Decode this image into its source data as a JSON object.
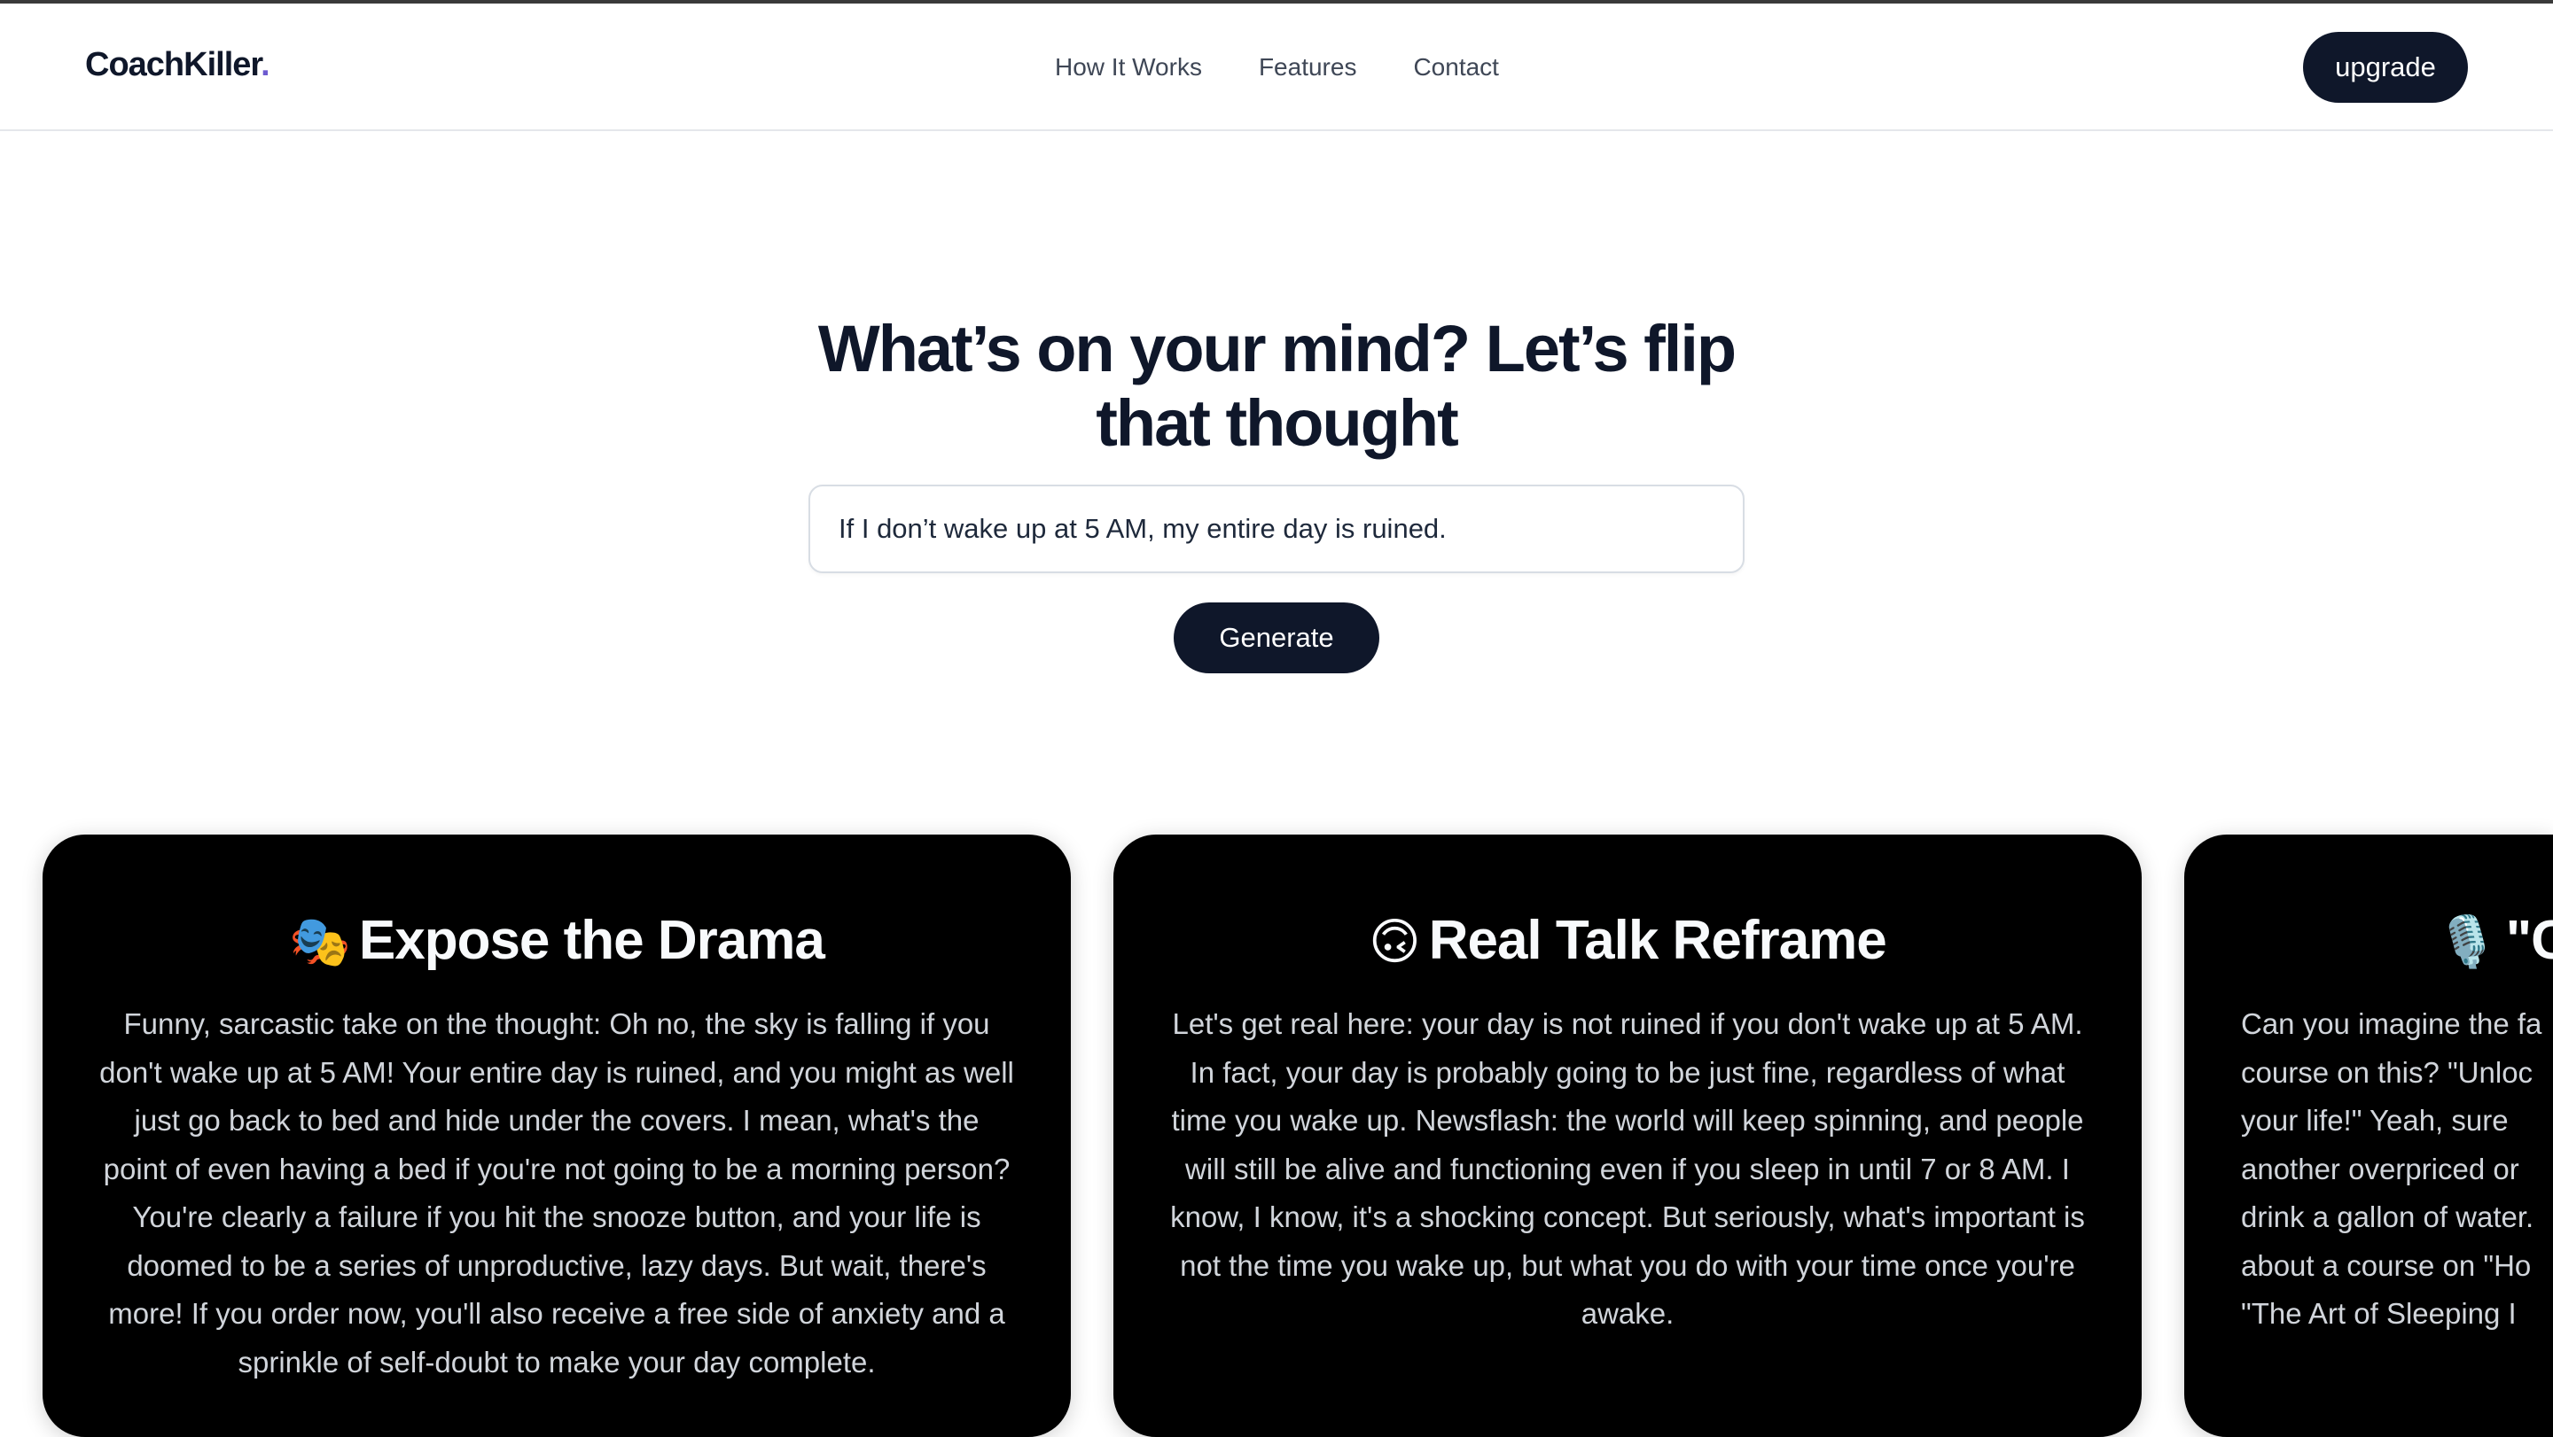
{
  "brand": {
    "name": "CoachKiller",
    "dot": "."
  },
  "nav": {
    "links": [
      "How It Works",
      "Features",
      "Contact"
    ],
    "upgrade_label": "upgrade"
  },
  "hero": {
    "title": "What’s on your mind? Let’s flip that thought",
    "input_value": "If I don’t wake up at 5 AM, my entire day is ruined.",
    "generate_label": "Generate"
  },
  "cards": [
    {
      "icon": "🎭",
      "icon_name": "performing-arts-icon",
      "title": "Expose the Drama",
      "body": "Funny, sarcastic take on the thought: Oh no, the sky is falling if you don't wake up at 5 AM! Your entire day is ruined, and you might as well just go back to bed and hide under the covers. I mean, what's the point of even having a bed if you're not going to be a morning person? You're clearly a failure if you hit the snooze button, and your life is doomed to be a series of unproductive, lazy days. But wait, there's more! If you order now, you'll also receive a free side of anxiety and a sprinkle of self-doubt to make your day complete."
    },
    {
      "icon": "🙃",
      "icon_name": "upside-down-face-icon",
      "title": "Real Talk Reframe",
      "body": "Let's get real here: your day is not ruined if you don't wake up at 5 AM. In fact, your day is probably going to be just fine, regardless of what time you wake up. Newsflash: the world will keep spinning, and people will still be alive and functioning even if you sleep in until 7 or 8 AM. I know, I know, it's a shocking concept. But seriously, what's important is not the time you wake up, but what you do with your time once you're awake."
    },
    {
      "icon": "🎙️",
      "icon_name": "microphone-icon",
      "title": "\"Co",
      "body": "Can you imagine the fa course on this? \"Unloc your life!\" Yeah, sure another overpriced or drink a gallon of water. about a course on \"Ho \"The Art of Sleeping I"
    }
  ],
  "colors": {
    "primary": "#0f172a",
    "card_bg": "#000000",
    "brand_dot": "#6d5bd0"
  }
}
